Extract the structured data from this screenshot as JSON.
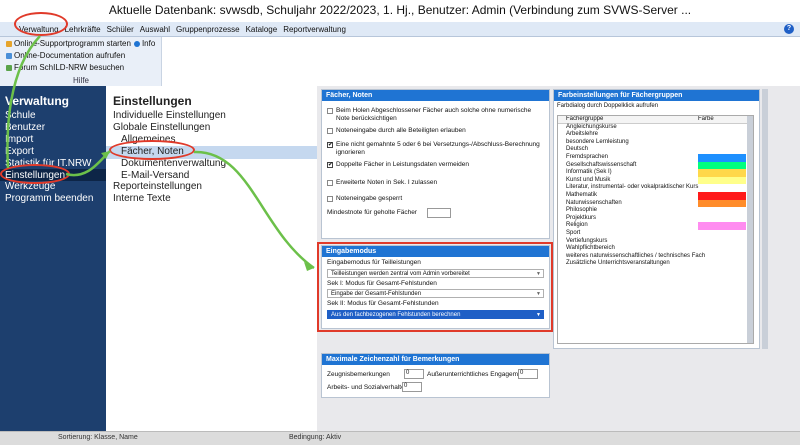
{
  "window": {
    "title": "Aktuelle Datenbank: svwsdb, Schuljahr 2022/2023, 1. Hj., Benutzer: Admin (Verbindung zum SVWS-Server ..."
  },
  "menu": [
    "Verwaltung",
    "Lehrkräfte",
    "Schüler",
    "Auswahl",
    "Gruppenprozesse",
    "Kataloge",
    "Reportverwaltung"
  ],
  "help_glyph": "?",
  "ribbon": {
    "items": [
      "Online-Supportprogramm starten",
      "Info",
      "Online-Documentation aufrufen",
      "Forum SchILD-NRW besuchen"
    ],
    "group_label": "Hilfe"
  },
  "left": {
    "title": "Verwaltung",
    "items": [
      "Schule",
      "Benutzer",
      "Import",
      "Export",
      "Statistik für IT.NRW",
      "Einstellungen",
      "Werkzeuge",
      "Programm beenden"
    ]
  },
  "middle": {
    "title": "Einstellungen",
    "items": [
      "Individuelle Einstellungen",
      "Globale Einstellungen",
      "Allgemeines",
      "Fächer, Noten",
      "Dokumentenverwaltung",
      "E-Mail-Versand",
      "Reporteinstellungen",
      "Interne Texte"
    ]
  },
  "faecher": {
    "header": "Fächer, Noten",
    "options": [
      {
        "label": "Beim Holen Abgeschlossener Fächer auch solche ohne numerische Note berücksichtigen",
        "checked": false
      },
      {
        "label": "Noteneingabe durch alle Beteiligten erlauben",
        "checked": false
      },
      {
        "label": "Eine nicht gemahnte 5 oder 6 bei Versetzungs-/Abschluss-Berechnung ignorieren",
        "checked": true
      },
      {
        "label": "Doppelte Fächer in Leistungsdaten vermeiden",
        "checked": true
      },
      {
        "label": "Erweiterte Noten in Sek. I zulassen",
        "checked": false
      },
      {
        "label": "Noteneingabe gesperrt",
        "checked": false
      }
    ],
    "mindest_label": "Mindestnote für geholte Fächer",
    "mindest_value": ""
  },
  "eingabe": {
    "header": "Eingabemodus",
    "l1": "Eingabemodus für Teilleistungen",
    "v1": "Teilleistungen werden zentral vom Admin vorbereitet",
    "l2": "Sek I: Modus für Gesamt-Fehlstunden",
    "v2": "Eingabe der Gesamt-Fehlstunden",
    "l3": "Sek II: Modus für Gesamt-Fehlstunden",
    "v3": "Aus den fachbezogenen Fehlstunden berechnen"
  },
  "zeichen": {
    "header": "Maximale Zeichenzahl für Bemerkungen",
    "zeugnis_label": "Zeugnisbemerkungen",
    "zeugnis_value": "0",
    "ausser_label": "Außerunterrichtliches Engagement",
    "ausser_value": "0",
    "arbeit_label": "Arbeits- und Sozialverhalten",
    "arbeit_value": "0"
  },
  "farben": {
    "header": "Farbeinstellungen für Fächergruppen",
    "hint": "Farbdialog durch Doppelklick aufrufen",
    "col_group": "Fächergruppe",
    "col_color": "Farbe",
    "rows": [
      {
        "name": "Angleichungskurse",
        "color": ""
      },
      {
        "name": "Arbeitslehre",
        "color": ""
      },
      {
        "name": "besondere Lernleistung",
        "color": ""
      },
      {
        "name": "Deutsch",
        "color": ""
      },
      {
        "name": "Fremdsprachen",
        "color": "#1e90ff"
      },
      {
        "name": "Gesellschaftswissenschaft",
        "color": "#00ff7f"
      },
      {
        "name": "Informatik (Sek I)",
        "color": "#ffd84a"
      },
      {
        "name": "Kunst und Musik",
        "color": "#ffff8a"
      },
      {
        "name": "Literatur, instrumental- oder vokalpraktischer Kurs",
        "color": ""
      },
      {
        "name": "Mathematik",
        "color": "#ff1a1a"
      },
      {
        "name": "Naturwissenschaften",
        "color": "#ff8c2a"
      },
      {
        "name": "Philosophie",
        "color": ""
      },
      {
        "name": "Projektkurs",
        "color": ""
      },
      {
        "name": "Religion",
        "color": "#ff8cf0"
      },
      {
        "name": "Sport",
        "color": ""
      },
      {
        "name": "Vertiefungskurs",
        "color": ""
      },
      {
        "name": "Wahlpflichtbereich",
        "color": ""
      },
      {
        "name": "weiteres naturwissenschaftliches / technisches Fach",
        "color": ""
      },
      {
        "name": "Zusätzliche Unterrichtsveranstaltungen",
        "color": ""
      }
    ]
  },
  "status": {
    "sort": "Sortierung: Klasse, Name",
    "filter": "Bedingung: Aktiv"
  }
}
